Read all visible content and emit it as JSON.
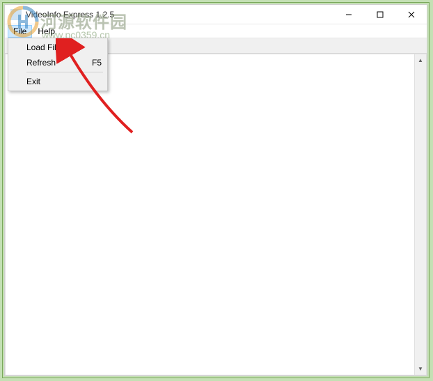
{
  "window": {
    "title": "VideoInfo Express 1.2.5"
  },
  "menubar": {
    "file": "File",
    "help": "Help"
  },
  "file_menu": {
    "load_file": "Load File",
    "refresh": "Refresh",
    "refresh_shortcut": "F5",
    "exit": "Exit"
  },
  "watermark": {
    "text_cn": "河源软件园",
    "url": "www.pc0359.cn"
  }
}
